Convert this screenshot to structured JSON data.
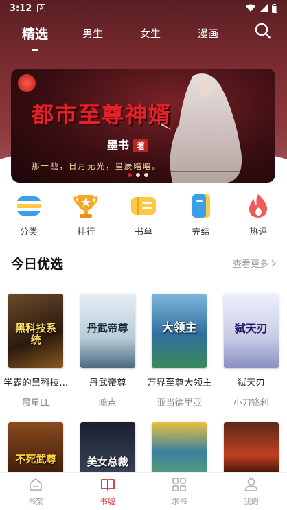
{
  "status_bar": {
    "time": "3:12",
    "notif": "A"
  },
  "top_tabs": [
    {
      "label": "精选",
      "active": true
    },
    {
      "label": "男生",
      "active": false
    },
    {
      "label": "女生",
      "active": false
    },
    {
      "label": "漫画",
      "active": false
    }
  ],
  "banner": {
    "title": "都市至尊神婿",
    "author": "墨书",
    "author_tag": "著",
    "slogan": "那一战，日月无光，星辰暗暗。",
    "dots": 3,
    "active_dot": 0
  },
  "categories": [
    {
      "label": "分类",
      "icon": "category-icon"
    },
    {
      "label": "排行",
      "icon": "trophy-icon"
    },
    {
      "label": "书单",
      "icon": "booklist-icon"
    },
    {
      "label": "完结",
      "icon": "finished-book-icon"
    },
    {
      "label": "热评",
      "icon": "flame-icon"
    }
  ],
  "section": {
    "title": "今日优选",
    "more": "查看更多"
  },
  "books_row1": [
    {
      "name": "学霸的黑科技...",
      "author": "晨星LL",
      "cover_text": "黑科技系统",
      "cover_color": "#3b2a1a"
    },
    {
      "name": "丹武帝尊",
      "author": "暗点",
      "cover_text": "丹武帝尊",
      "cover_color": "#cfdde8"
    },
    {
      "name": "万界至尊大领主",
      "author": "亚当德里亚",
      "cover_text": "大领主",
      "cover_color": "#2f6f9e"
    },
    {
      "name": "弑天刃",
      "author": "小刀锋利",
      "cover_text": "弑天刃",
      "cover_color": "#d9dcef"
    }
  ],
  "books_row2": [
    {
      "cover_text": "不死武尊",
      "cover_color": "#5a2a10"
    },
    {
      "cover_text": "美女总裁",
      "cover_color": "#2a3448"
    },
    {
      "cover_text": "",
      "cover_color": "#3a7fa0"
    },
    {
      "cover_text": "",
      "cover_color": "#3a1a10"
    }
  ],
  "bottom_nav": [
    {
      "label": "书架",
      "icon": "bookshelf-icon",
      "active": false
    },
    {
      "label": "书城",
      "icon": "bookstore-icon",
      "active": true
    },
    {
      "label": "求书",
      "icon": "request-book-icon",
      "active": false
    },
    {
      "label": "我的",
      "icon": "profile-icon",
      "active": false
    }
  ],
  "colors": {
    "accent": "#c9313a",
    "header": "#7a2c31"
  }
}
